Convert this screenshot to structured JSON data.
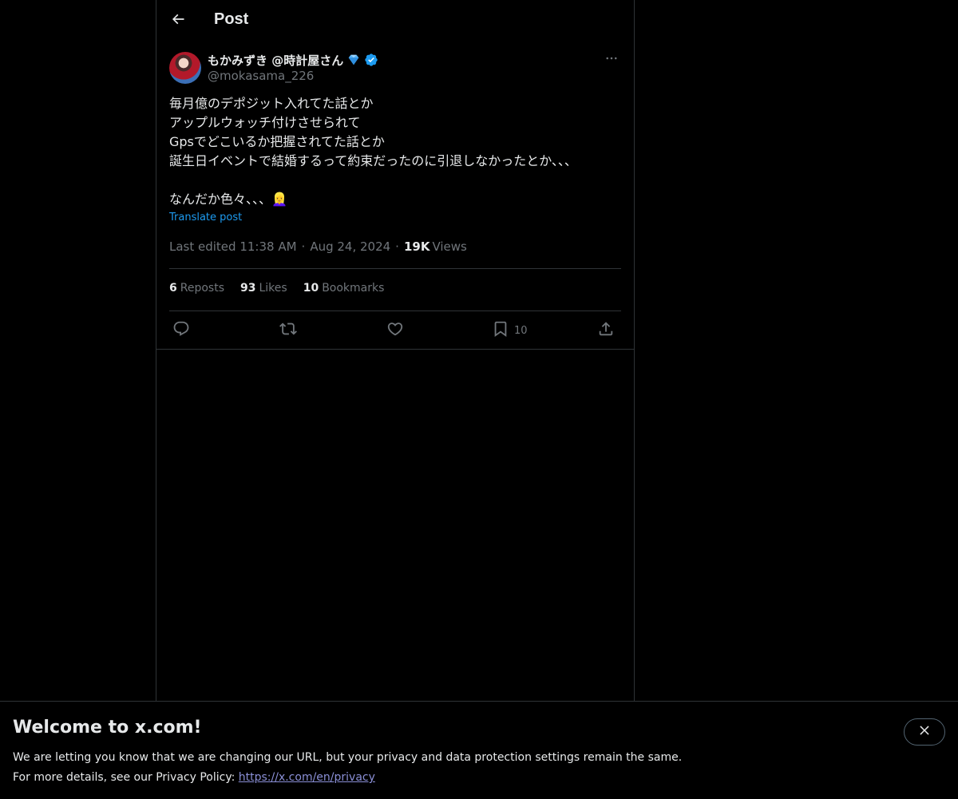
{
  "header": {
    "title": "Post",
    "back_icon": "arrow-left-icon"
  },
  "post": {
    "author": {
      "display_name": "もかみずき @時計屋さん",
      "handle": "@mokasama_226",
      "badges": [
        "gem-icon",
        "verified-icon"
      ]
    },
    "text": "毎月億のデポジット入れてた話とか\nアップルウォッチ付けさせられて\nGpsでどこいるか把握されてた話とか\n誕生日イベントで結婚するって約束だったのに引退しなかったとか、、、\n\nなんだか色々、、、👱‍♀️",
    "translate_label": "Translate post",
    "meta": {
      "edited_label": "Last edited 11:38 AM",
      "separator": "·",
      "date": "Aug 24, 2024",
      "views_count": "19K",
      "views_label": "Views"
    },
    "stats": {
      "reposts_count": "6",
      "reposts_label": "Reposts",
      "likes_count": "93",
      "likes_label": "Likes",
      "bookmarks_count": "10",
      "bookmarks_label": "Bookmarks"
    },
    "actions": {
      "bookmark_count": "10"
    }
  },
  "banner": {
    "title": "Welcome to x.com!",
    "line1": "We are letting you know that we are changing our URL, but your privacy and data protection settings remain the same.",
    "line2_prefix": "For more details, see our Privacy Policy: ",
    "link_text": "https://x.com/en/privacy"
  },
  "colors": {
    "background": "#000000",
    "text": "#e7e9ea",
    "muted": "#71767b",
    "accent": "#1d9bf0",
    "border": "#2f3336"
  }
}
